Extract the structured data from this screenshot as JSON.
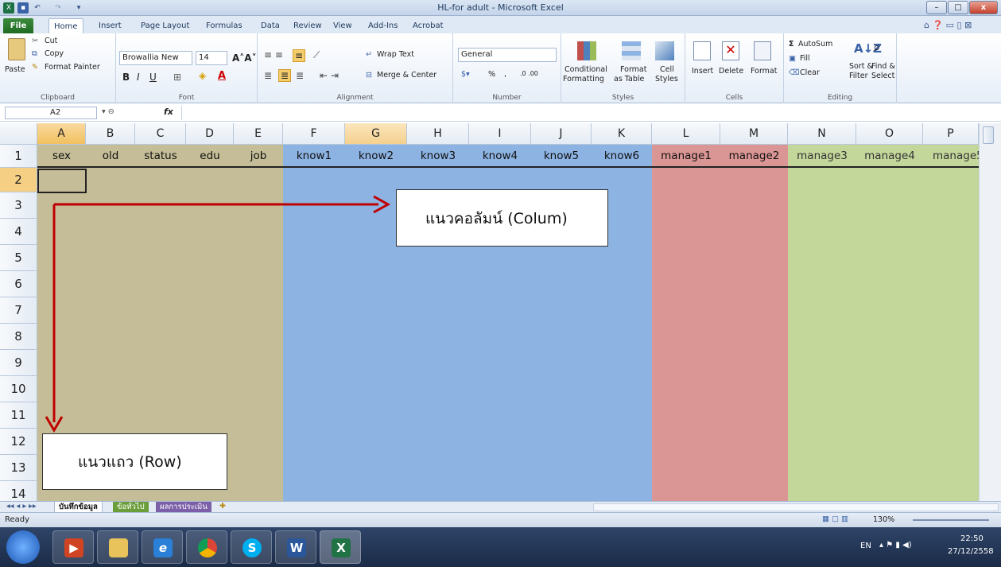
{
  "window": {
    "title": "HL-for adult - Microsoft Excel",
    "min": "–",
    "max": "□",
    "close": "x"
  },
  "ribbon_tabs": [
    "File",
    "Home",
    "Insert",
    "Page Layout",
    "Formulas",
    "Data",
    "Review",
    "View",
    "Add-Ins",
    "Acrobat"
  ],
  "clipboard": {
    "paste": "Paste",
    "cut": "Cut",
    "copy": "Copy",
    "format_painter": "Format Painter",
    "label": "Clipboard"
  },
  "font": {
    "name": "Browallia New",
    "size": "14",
    "label": "Font"
  },
  "alignment": {
    "wrap": "Wrap Text",
    "merge": "Merge & Center",
    "label": "Alignment"
  },
  "number": {
    "format": "General",
    "percent": "%",
    "comma": ",",
    "label": "Number"
  },
  "styles": {
    "conditional": "Conditional",
    "conditional2": "Formatting",
    "format_table": "Format",
    "format_table2": "as Table",
    "cell_styles": "Cell",
    "cell_styles2": "Styles",
    "label": "Styles"
  },
  "cells": {
    "insert": "Insert",
    "delete": "Delete",
    "format": "Format",
    "label": "Cells"
  },
  "editing": {
    "autosum": "AutoSum",
    "fill": "Fill",
    "clear": "Clear",
    "sort": "Sort &",
    "sort2": "Filter",
    "find": "Find &",
    "find2": "Select",
    "label": "Editing"
  },
  "formula_bar": {
    "name_box": "A2",
    "fx": "fx",
    "value": ""
  },
  "columns": [
    "A",
    "B",
    "C",
    "D",
    "E",
    "F",
    "G",
    "H",
    "I",
    "J",
    "K",
    "L",
    "M",
    "N",
    "O",
    "P"
  ],
  "rows": [
    "1",
    "2",
    "3",
    "4",
    "5",
    "6",
    "7",
    "8",
    "9",
    "10",
    "11",
    "12",
    "13",
    "14"
  ],
  "header_row": [
    "sex",
    "old",
    "status",
    "edu",
    "job",
    "know1",
    "know2",
    "know3",
    "know4",
    "know5",
    "know6",
    "manage1",
    "manage2",
    "manage3",
    "manage4",
    "manage5"
  ],
  "callouts": {
    "column": "แนวคอลัมน์ (Colum)",
    "row": "แนวแถว (Row)"
  },
  "sheets": [
    "บันทึกข้อมูล",
    "ข้อทั่วไป",
    "ผลการประเมิน"
  ],
  "status": {
    "ready": "Ready",
    "zoom": "130%"
  },
  "taskbar": {
    "lang": "EN",
    "time": "22:50",
    "date": "27/12/2558"
  },
  "colors": {
    "tan": "#c4bd97",
    "blue": "#8db3e2",
    "red": "#da9694",
    "green": "#c4d79b",
    "arrow": "#c00000"
  }
}
